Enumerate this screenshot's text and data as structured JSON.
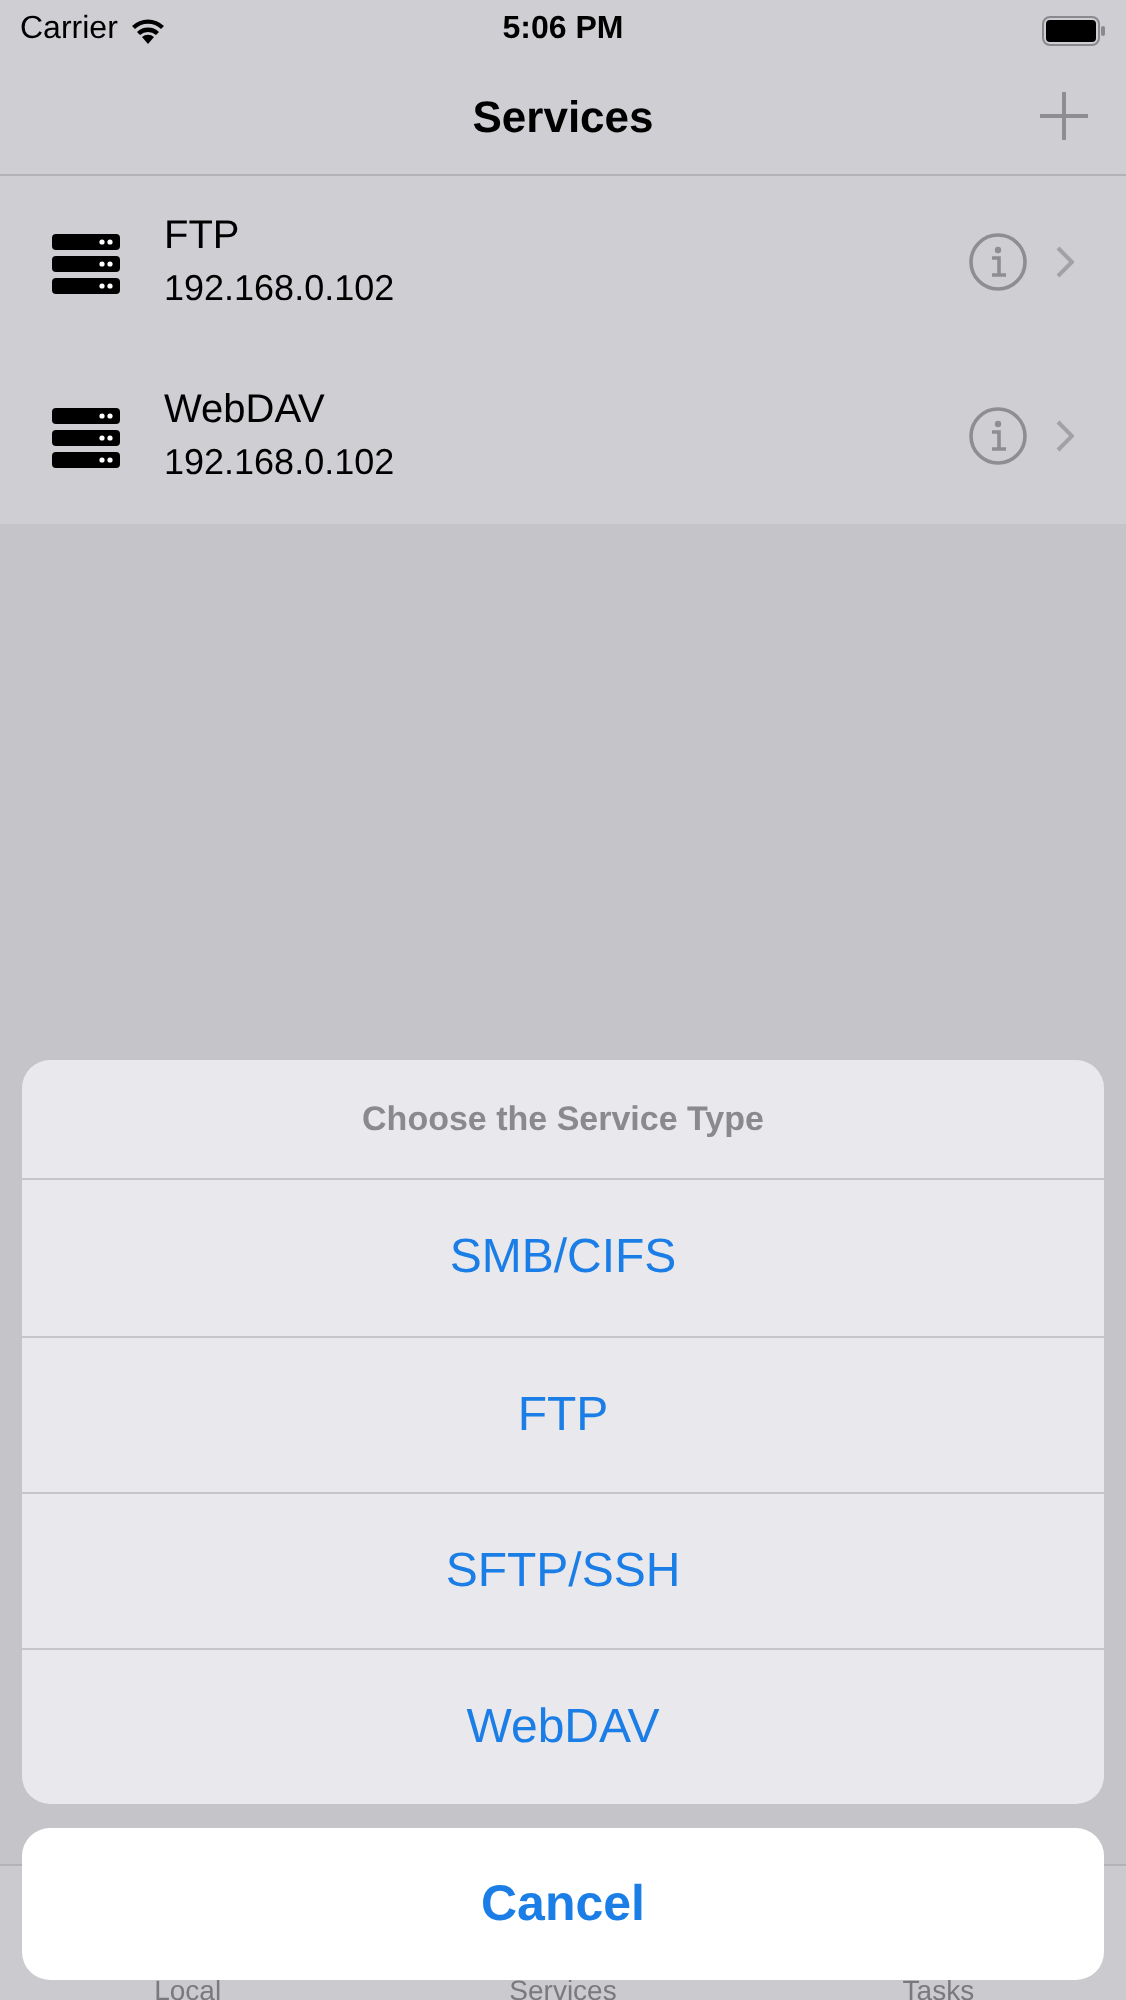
{
  "status_bar": {
    "carrier": "Carrier",
    "time": "5:06 PM"
  },
  "nav": {
    "title": "Services"
  },
  "services": [
    {
      "name": "FTP",
      "address": "192.168.0.102"
    },
    {
      "name": "WebDAV",
      "address": "192.168.0.102"
    }
  ],
  "tab_bar": {
    "tabs": [
      {
        "label": "Local"
      },
      {
        "label": "Services"
      },
      {
        "label": "Tasks"
      }
    ]
  },
  "action_sheet": {
    "title": "Choose the Service Type",
    "options": [
      "SMB/CIFS",
      "FTP",
      "SFTP/SSH",
      "WebDAV"
    ],
    "cancel": "Cancel"
  }
}
